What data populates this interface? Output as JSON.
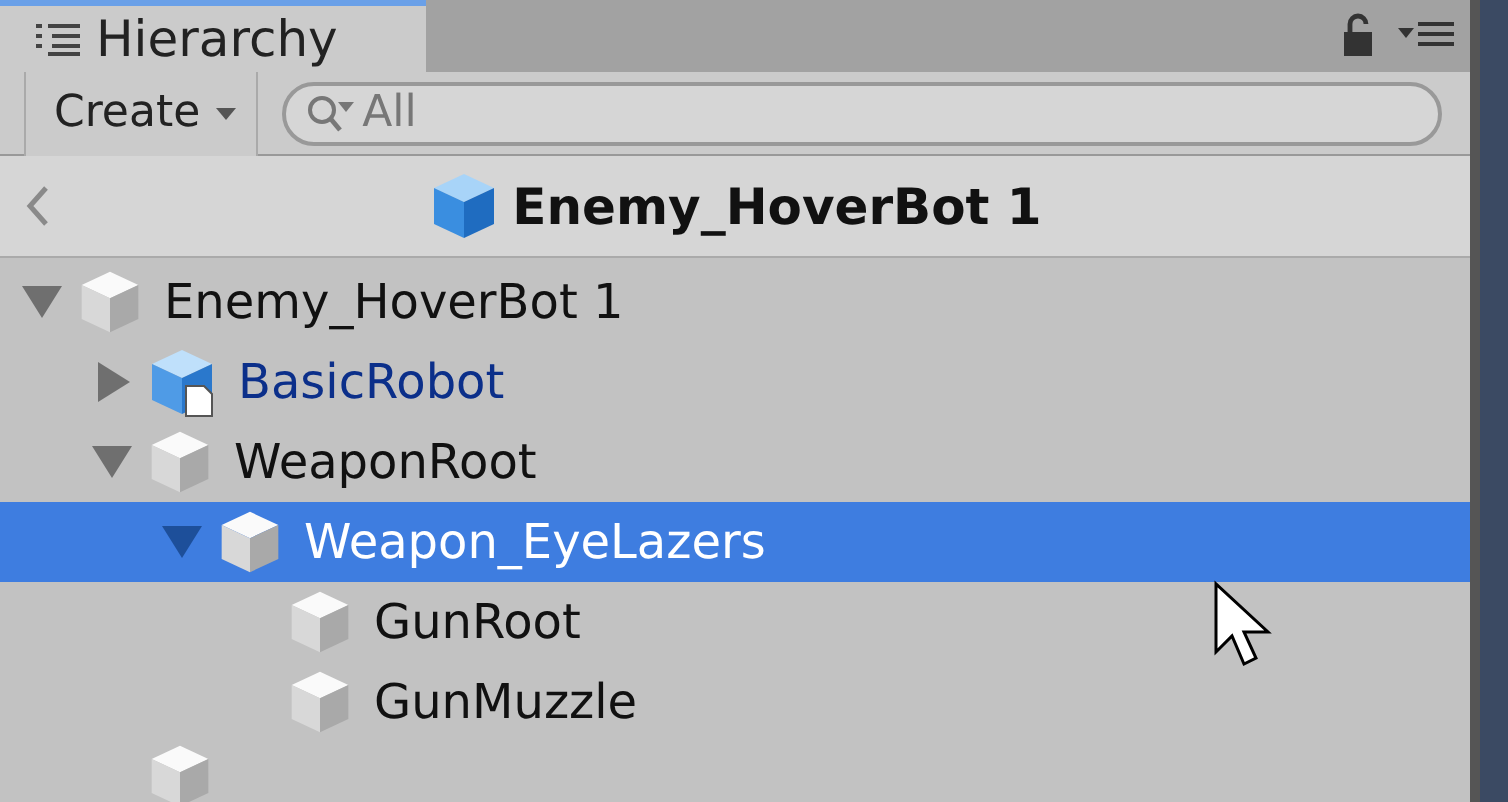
{
  "window": {
    "tab": {
      "title": "Hierarchy",
      "selected": true
    }
  },
  "toolbar": {
    "create_button": "Create",
    "search": {
      "placeholder": "All"
    }
  },
  "header": {
    "title": "Enemy_HoverBot 1"
  },
  "tree": [
    {
      "label": "Enemy_HoverBot 1",
      "kind": "object",
      "expanded": true,
      "selected": false,
      "children": [
        {
          "label": "BasicRobot",
          "kind": "prefab",
          "expanded": false,
          "selected": false
        },
        {
          "label": "WeaponRoot",
          "kind": "object",
          "expanded": true,
          "selected": false,
          "children": [
            {
              "label": "Weapon_EyeLazers",
              "kind": "object",
              "expanded": true,
              "selected": true,
              "children": [
                {
                  "label": "GunRoot",
                  "kind": "object",
                  "selected": false
                },
                {
                  "label": "GunMuzzle",
                  "kind": "object",
                  "selected": false
                }
              ]
            }
          ]
        },
        {
          "kind": "object",
          "selected": false,
          "partial": true
        }
      ]
    }
  ]
}
